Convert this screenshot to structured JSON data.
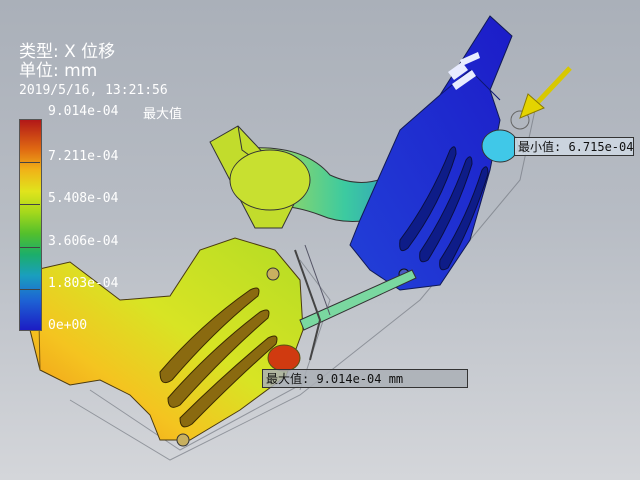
{
  "result": {
    "type_line": "类型: X 位移",
    "unit_line": "单位: mm",
    "timestamp": "2019/5/16, 13:21:56"
  },
  "legend": {
    "max_label": "9.014e-04",
    "max_tag": "最大值",
    "ticks": [
      "7.211e-04",
      "5.408e-04",
      "3.606e-04",
      "1.803e-04",
      "0e+00"
    ],
    "colors": [
      "#b21818",
      "#e06a12",
      "#f0b418",
      "#e0e41c",
      "#a4d81c",
      "#54c02c",
      "#1cae6a",
      "#1a9fbe",
      "#1d62d4",
      "#1c1cc4"
    ]
  },
  "callouts": {
    "min": "最小值: 6.715e-04",
    "max": "最大值: 9.014e-04 mm"
  }
}
